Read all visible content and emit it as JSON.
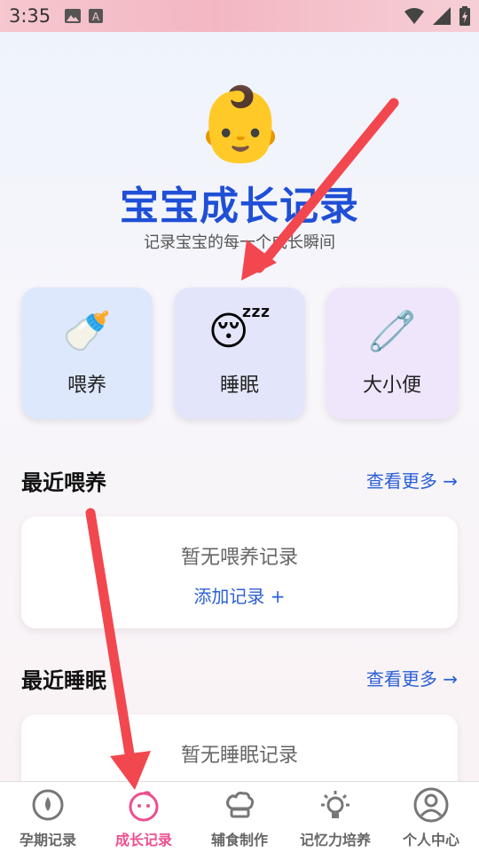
{
  "status_bar": {
    "time": "3:35",
    "icons_left": [
      "image-icon",
      "a-icon"
    ],
    "icons_right": [
      "wifi-icon",
      "signal-icon",
      "battery-charging-icon"
    ]
  },
  "hero": {
    "emoji": "👶",
    "title": "宝宝成长记录",
    "subtitle": "记录宝宝的每一个成长瞬间"
  },
  "categories": [
    {
      "label": "喂养",
      "emoji": "🍼",
      "icon": "baby-bottle-icon"
    },
    {
      "label": "睡眠",
      "emoji": "😴",
      "icon": "sleeping-face-icon"
    },
    {
      "label": "大小便",
      "emoji": "🧷",
      "icon": "safety-pin-icon"
    }
  ],
  "feeding_section": {
    "title": "最近喂养",
    "more_label": "查看更多 →",
    "empty_text": "暂无喂养记录",
    "add_label": "添加记录 +"
  },
  "sleep_section": {
    "title": "最近睡眠",
    "more_label": "查看更多 →",
    "empty_text": "暂无睡眠记录"
  },
  "bottom_nav": [
    {
      "label": "孕期记录",
      "icon": "drop-circle-icon",
      "active": false
    },
    {
      "label": "成长记录",
      "icon": "baby-face-icon",
      "active": true
    },
    {
      "label": "辅食制作",
      "icon": "chef-hat-icon",
      "active": false
    },
    {
      "label": "记忆力培养",
      "icon": "lightbulb-icon",
      "active": false
    },
    {
      "label": "个人中心",
      "icon": "user-circle-icon",
      "active": false
    }
  ],
  "colors": {
    "accent": "#1f4fd6",
    "link": "#2a5fd6",
    "active_nav": "#ec4f8f",
    "annotation_arrow": "#f2474f"
  }
}
